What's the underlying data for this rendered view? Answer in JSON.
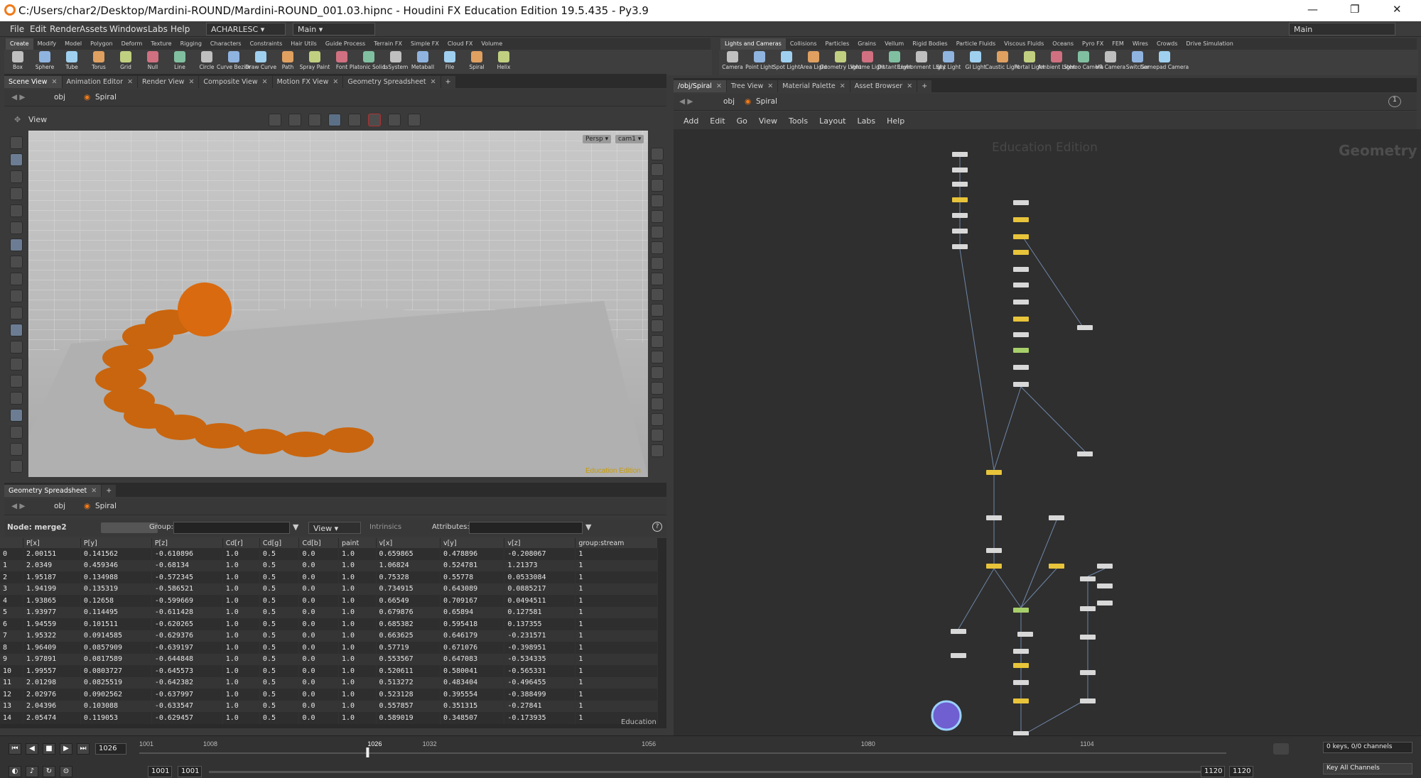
{
  "window": {
    "title": "C:/Users/char2/Desktop/Mardini-ROUND/Mardini-ROUND_001.03.hipnc - Houdini FX Education Edition 19.5.435 - Py3.9",
    "min": "—",
    "max": "❐",
    "close": "✕"
  },
  "menubar": {
    "items": [
      "File",
      "Edit",
      "Render",
      "Assets",
      "Windows",
      "Labs",
      "Help"
    ],
    "colorspace": "ACHARLESC",
    "desktop": "Main",
    "desktop_right": "Main"
  },
  "shelf_left": {
    "tabs": [
      "Create",
      "Modify",
      "Model",
      "Polygon",
      "Deform",
      "Texture",
      "Rigging",
      "Characters",
      "Constraints",
      "Hair Utils",
      "Guide Process",
      "Terrain FX",
      "Simple FX",
      "Cloud FX",
      "Volume"
    ],
    "tools": [
      "Box",
      "Sphere",
      "Tube",
      "Torus",
      "Grid",
      "Null",
      "Line",
      "Circle",
      "Curve Bezier",
      "Draw Curve",
      "Path",
      "Spray Paint",
      "Font",
      "Platonic Solids",
      "L-System",
      "Metaball",
      "File",
      "Spiral",
      "Helix"
    ]
  },
  "shelf_right": {
    "tabs": [
      "Lights and Cameras",
      "Collisions",
      "Particles",
      "Grains",
      "Vellum",
      "Rigid Bodies",
      "Particle Fluids",
      "Viscous Fluids",
      "Oceans",
      "Pyro FX",
      "FEM",
      "Wires",
      "Crowds",
      "Drive Simulation"
    ],
    "tools": [
      "Camera",
      "Point Light",
      "Spot Light",
      "Area Light",
      "Geometry Light",
      "Volume Light",
      "Distant Light",
      "Environment Light",
      "Sky Light",
      "GI Light",
      "Caustic Light",
      "Portal Light",
      "Ambient Light",
      "Stereo Camera",
      "VR Camera",
      "Switcher",
      "Gamepad Camera"
    ]
  },
  "left_pane": {
    "tabs": [
      "Scene View",
      "Animation Editor",
      "Render View",
      "Composite View",
      "Motion FX View",
      "Geometry Spreadsheet"
    ],
    "path": [
      "obj",
      "Spiral"
    ],
    "view_label": "View",
    "persp": "Persp",
    "cam": "cam1",
    "watermark": "Education Edition"
  },
  "spreadsheet": {
    "tab": "Geometry Spreadsheet",
    "path": [
      "obj",
      "Spiral"
    ],
    "node_label": "Node: merge2",
    "group_label": "Group:",
    "view_label": "View",
    "intrinsics_label": "Intrinsics",
    "attributes_label": "Attributes:",
    "watermark": "Education",
    "columns": [
      "",
      "P[x]",
      "P[y]",
      "P[z]",
      "Cd[r]",
      "Cd[g]",
      "Cd[b]",
      "paint",
      "v[x]",
      "v[y]",
      "v[z]",
      "group:stream"
    ],
    "rows": [
      [
        "0",
        "2.00151",
        "0.141562",
        "-0.610896",
        "1.0",
        "0.5",
        "0.0",
        "1.0",
        "0.659865",
        "0.478896",
        "-0.208067",
        "1"
      ],
      [
        "1",
        "2.0349",
        "0.459346",
        "-0.68134",
        "1.0",
        "0.5",
        "0.0",
        "1.0",
        "1.06824",
        "0.524781",
        "1.21373",
        "1"
      ],
      [
        "2",
        "1.95187",
        "0.134988",
        "-0.572345",
        "1.0",
        "0.5",
        "0.0",
        "1.0",
        "0.75328",
        "0.55778",
        "0.0533084",
        "1"
      ],
      [
        "3",
        "1.94199",
        "0.135319",
        "-0.586521",
        "1.0",
        "0.5",
        "0.0",
        "1.0",
        "0.734915",
        "0.643089",
        "0.0885217",
        "1"
      ],
      [
        "4",
        "1.93865",
        "0.12658",
        "-0.599669",
        "1.0",
        "0.5",
        "0.0",
        "1.0",
        "0.66549",
        "0.709167",
        "0.0494511",
        "1"
      ],
      [
        "5",
        "1.93977",
        "0.114495",
        "-0.611428",
        "1.0",
        "0.5",
        "0.0",
        "1.0",
        "0.679876",
        "0.65894",
        "0.127581",
        "1"
      ],
      [
        "6",
        "1.94559",
        "0.101511",
        "-0.620265",
        "1.0",
        "0.5",
        "0.0",
        "1.0",
        "0.685382",
        "0.595418",
        "0.137355",
        "1"
      ],
      [
        "7",
        "1.95322",
        "0.0914585",
        "-0.629376",
        "1.0",
        "0.5",
        "0.0",
        "1.0",
        "0.663625",
        "0.646179",
        "-0.231571",
        "1"
      ],
      [
        "8",
        "1.96409",
        "0.0857909",
        "-0.639197",
        "1.0",
        "0.5",
        "0.0",
        "1.0",
        "0.57719",
        "0.671076",
        "-0.398951",
        "1"
      ],
      [
        "9",
        "1.97891",
        "0.0817589",
        "-0.644848",
        "1.0",
        "0.5",
        "0.0",
        "1.0",
        "0.553567",
        "0.647083",
        "-0.534335",
        "1"
      ],
      [
        "10",
        "1.99557",
        "0.0803727",
        "-0.645573",
        "1.0",
        "0.5",
        "0.0",
        "1.0",
        "0.520611",
        "0.580041",
        "-0.565331",
        "1"
      ],
      [
        "11",
        "2.01298",
        "0.0825519",
        "-0.642382",
        "1.0",
        "0.5",
        "0.0",
        "1.0",
        "0.513272",
        "0.483404",
        "-0.496455",
        "1"
      ],
      [
        "12",
        "2.02976",
        "0.0902562",
        "-0.637997",
        "1.0",
        "0.5",
        "0.0",
        "1.0",
        "0.523128",
        "0.395554",
        "-0.388499",
        "1"
      ],
      [
        "13",
        "2.04396",
        "0.103088",
        "-0.633547",
        "1.0",
        "0.5",
        "0.0",
        "1.0",
        "0.557857",
        "0.351315",
        "-0.27841",
        "1"
      ],
      [
        "14",
        "2.05474",
        "0.119053",
        "-0.629457",
        "1.0",
        "0.5",
        "0.0",
        "1.0",
        "0.589019",
        "0.348507",
        "-0.173935",
        "1"
      ]
    ]
  },
  "right_pane": {
    "tabs": [
      "/obj/Spiral",
      "Tree View",
      "Material Palette",
      "Asset Browser"
    ],
    "path": [
      "obj",
      "Spiral"
    ],
    "menu": [
      "Add",
      "Edit",
      "Go",
      "View",
      "Tools",
      "Layout",
      "Labs",
      "Help"
    ],
    "watermark": "Education Edition",
    "context_label": "Geometry",
    "badge": "1"
  },
  "timeline": {
    "current_frame": "1026",
    "ticks": [
      "1001",
      "1008",
      "1026",
      "1032",
      "1056",
      "1080",
      "1104"
    ],
    "start": "1001",
    "start2": "1001",
    "end": "1120",
    "end2": "1120",
    "keys_label": "0 keys, 0/0 channels",
    "key_all": "Key All Channels"
  },
  "colors": {
    "accent": "#f07a1a",
    "ball": "#d96a10",
    "node_default": "#d8d8d8",
    "node_yellow": "#e8c43a",
    "node_green": "#a8d06a"
  }
}
